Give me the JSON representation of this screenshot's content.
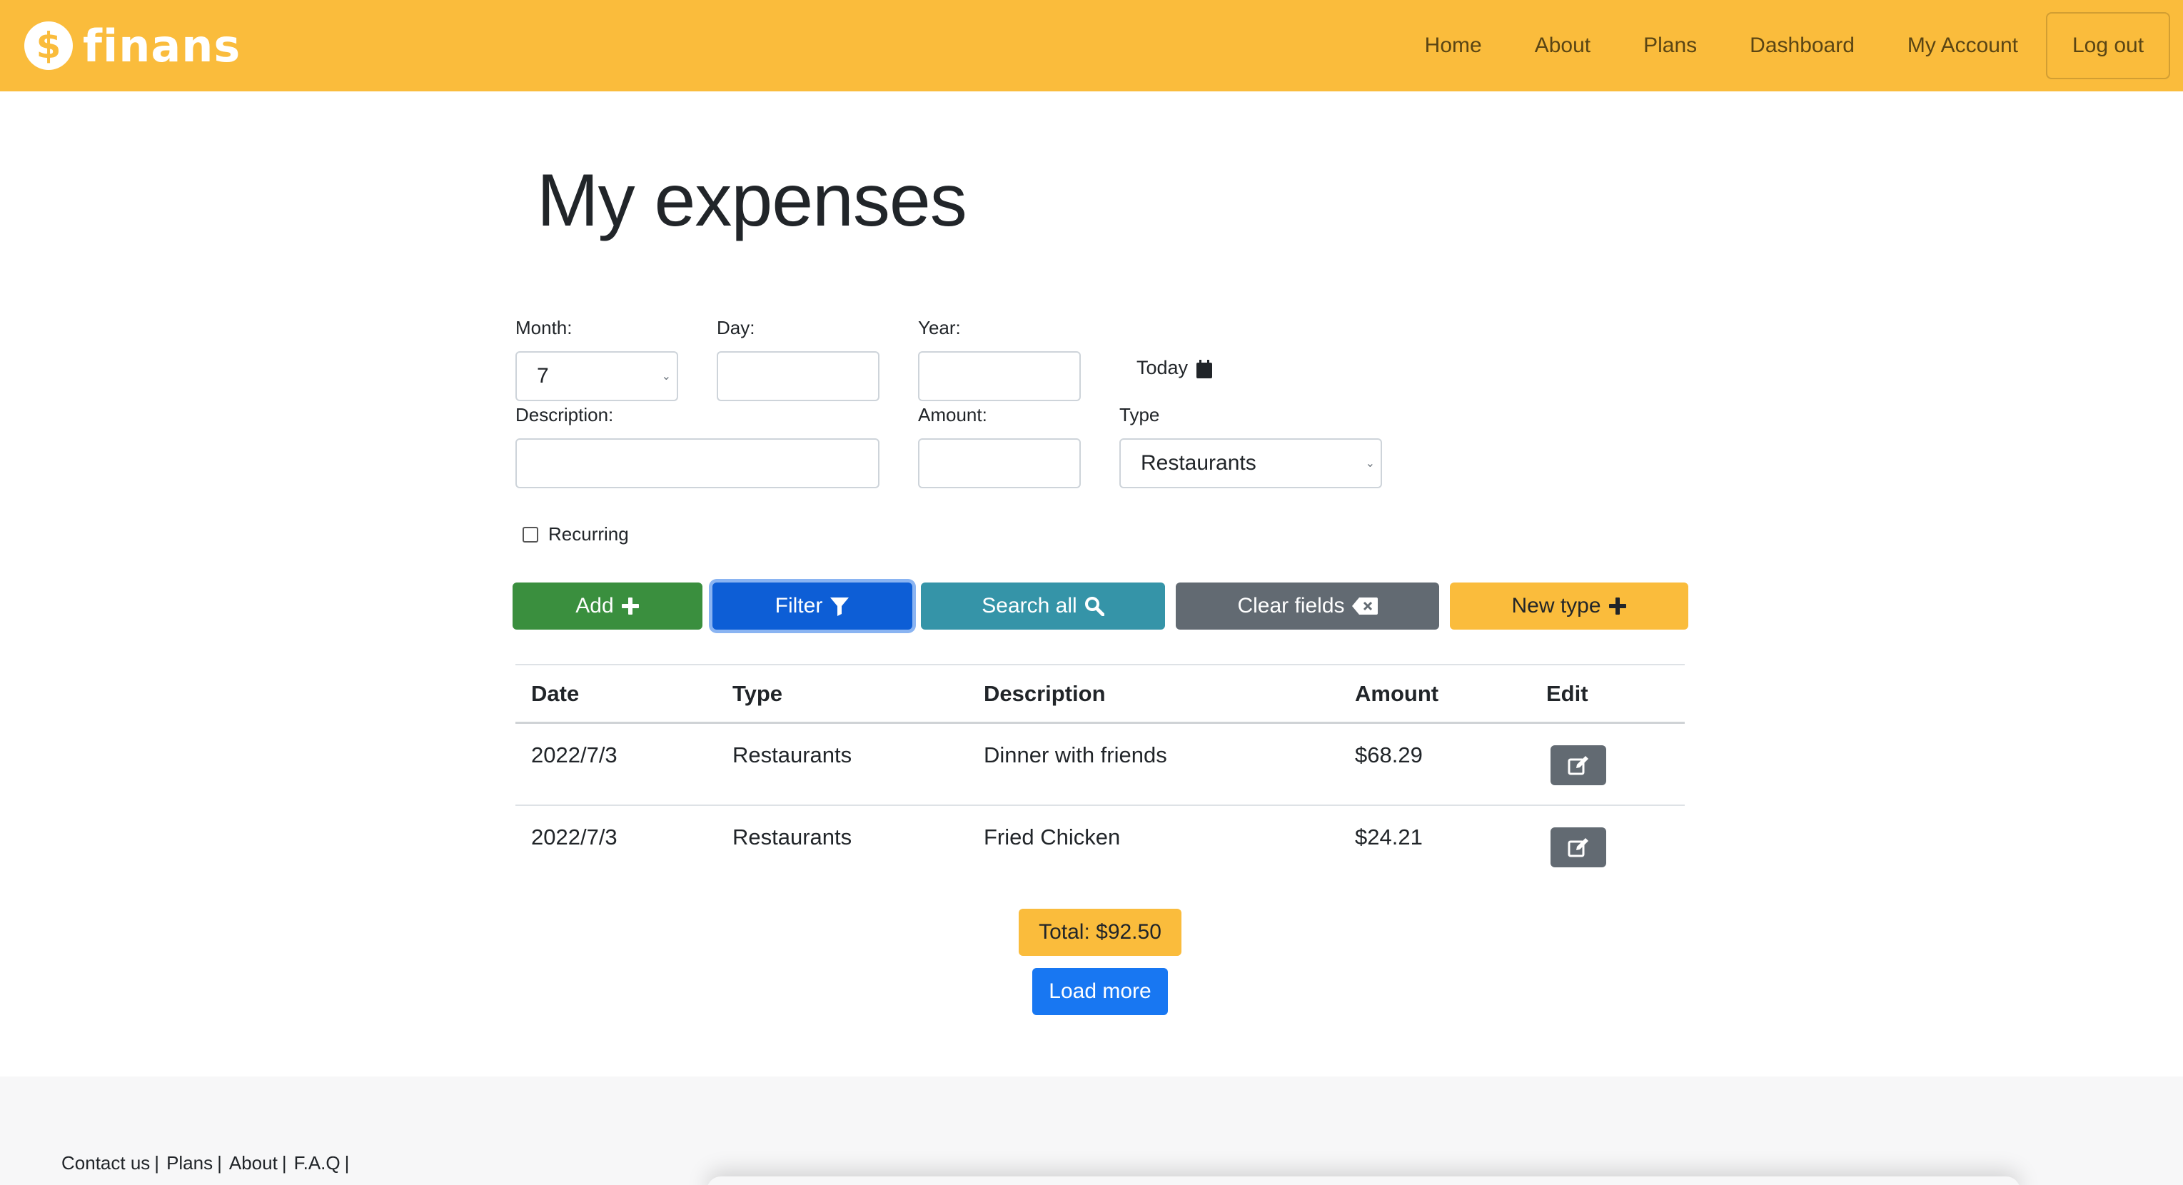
{
  "navbar": {
    "brand_symbol": "$",
    "brand_name": "finans",
    "links": [
      "Home",
      "About",
      "Plans",
      "Dashboard",
      "My Account"
    ],
    "logout": "Log out",
    "color": "#fabc3c"
  },
  "page": {
    "title": "My expenses"
  },
  "form": {
    "month_label": "Month:",
    "month_value": "7",
    "day_label": "Day:",
    "day_value": "",
    "year_label": "Year:",
    "year_value": "",
    "today_label": "Today",
    "description_label": "Description:",
    "description_value": "",
    "amount_label": "Amount:",
    "amount_value": "",
    "type_label": "Type",
    "type_value": "Restaurants",
    "recurring_label": "Recurring",
    "recurring_checked": false
  },
  "buttons": {
    "add": "Add",
    "filter": "Filter",
    "search_all": "Search all",
    "clear_fields": "Clear fields",
    "new_type": "New type"
  },
  "table": {
    "headers": [
      "Date",
      "Type",
      "Description",
      "Amount",
      "Edit"
    ],
    "rows": [
      {
        "date": "2022/7/3",
        "type": "Restaurants",
        "description": "Dinner with friends",
        "amount": "$68.29"
      },
      {
        "date": "2022/7/3",
        "type": "Restaurants",
        "description": "Fried Chicken",
        "amount": "$24.21"
      }
    ]
  },
  "summary": {
    "total": "Total: $92.50",
    "load_more": "Load more"
  },
  "footer": {
    "links": [
      "Contact us",
      "Plans",
      "About",
      "F.A.Q"
    ],
    "separator": "|"
  },
  "colors": {
    "add": "#3a8f3e",
    "filter": "#0d5ed6",
    "search": "#3594a8",
    "clear": "#626a72",
    "new_type": "#fabc3c",
    "load_more": "#1877f2"
  }
}
